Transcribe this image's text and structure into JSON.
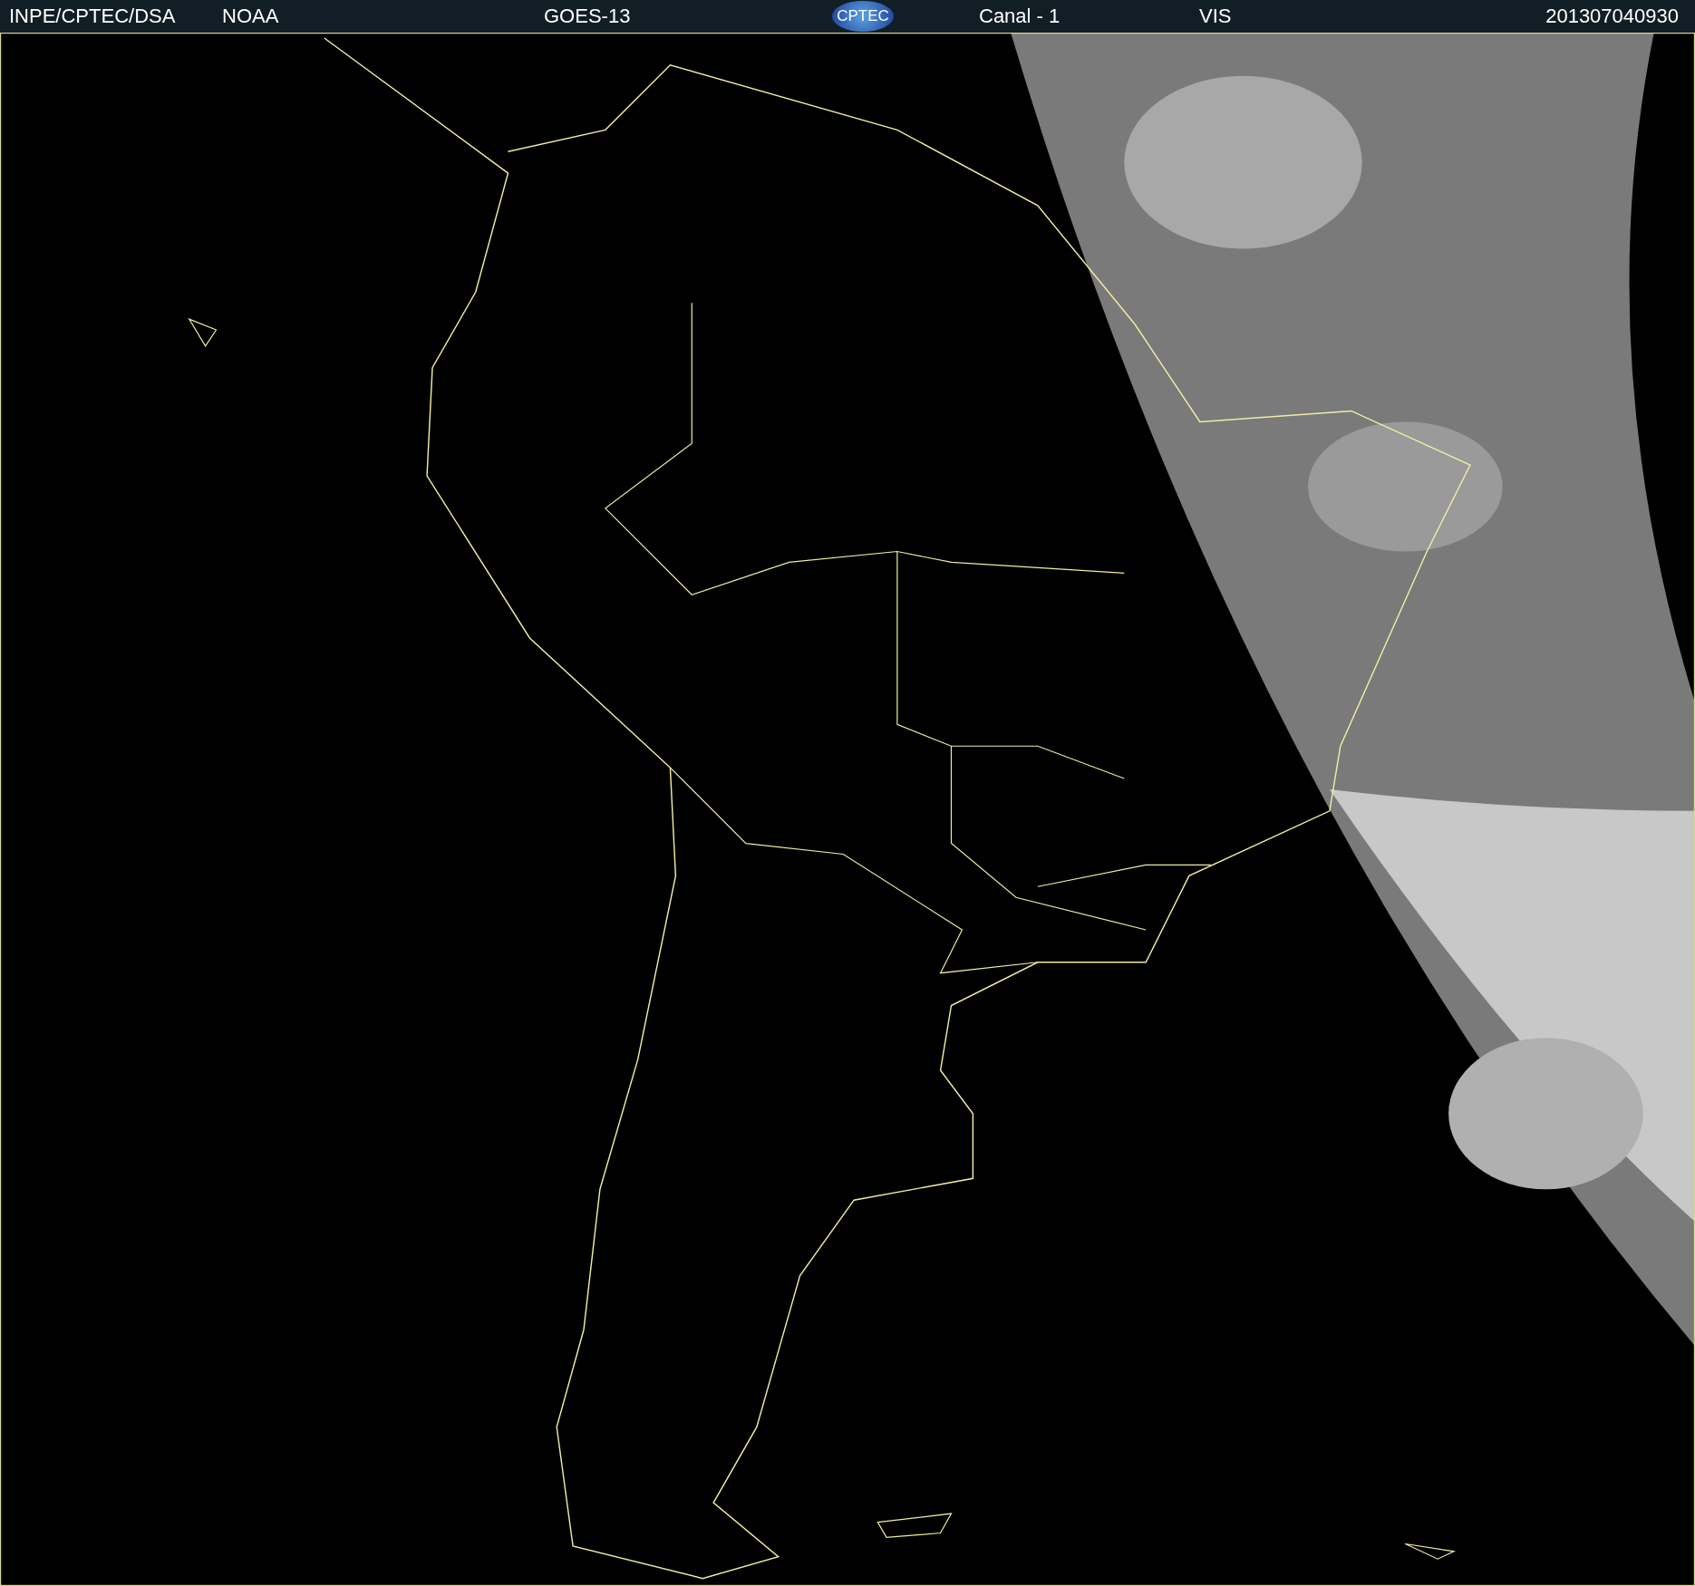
{
  "header": {
    "items": [
      {
        "kind": "text",
        "text": "INPE/CPTEC/DSA"
      },
      {
        "kind": "text",
        "text": "NOAA"
      },
      {
        "kind": "text",
        "text": "GOES-13"
      },
      {
        "kind": "logo",
        "text": "CPTEC"
      },
      {
        "kind": "text",
        "text": "Canal - 1"
      },
      {
        "kind": "text",
        "text": "VIS"
      },
      {
        "kind": "text",
        "text": "201307040930"
      }
    ]
  }
}
